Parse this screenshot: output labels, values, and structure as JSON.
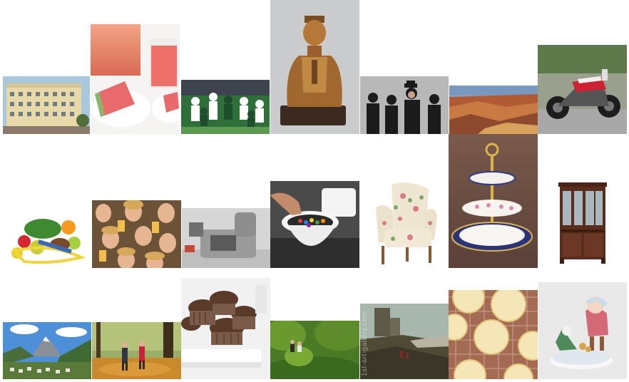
{
  "gallery": {
    "tiles": [
      {
        "subject": "hotel-building"
      },
      {
        "subject": "watermelon-juice"
      },
      {
        "subject": "football-game"
      },
      {
        "subject": "golden-statue"
      },
      {
        "subject": "band-portrait"
      },
      {
        "subject": "grand-canyon"
      },
      {
        "subject": "motorcycle"
      },
      {
        "subject": "fruit-and-tape-measure"
      },
      {
        "subject": "crowd-with-beer"
      },
      {
        "subject": "lab-machine"
      },
      {
        "subject": "candy-toilet"
      },
      {
        "subject": "floral-armchair"
      },
      {
        "subject": "cake-stand"
      },
      {
        "subject": "china-cabinet"
      },
      {
        "subject": "alpine-village"
      },
      {
        "subject": "autumn-walk"
      },
      {
        "subject": "chocolate-muffins"
      },
      {
        "subject": "couple-in-forest"
      },
      {
        "subject": "castle-painting"
      },
      {
        "subject": "iced-cookies"
      },
      {
        "subject": "child-figurine"
      }
    ],
    "watermark": "1st-art-gallery.com"
  }
}
